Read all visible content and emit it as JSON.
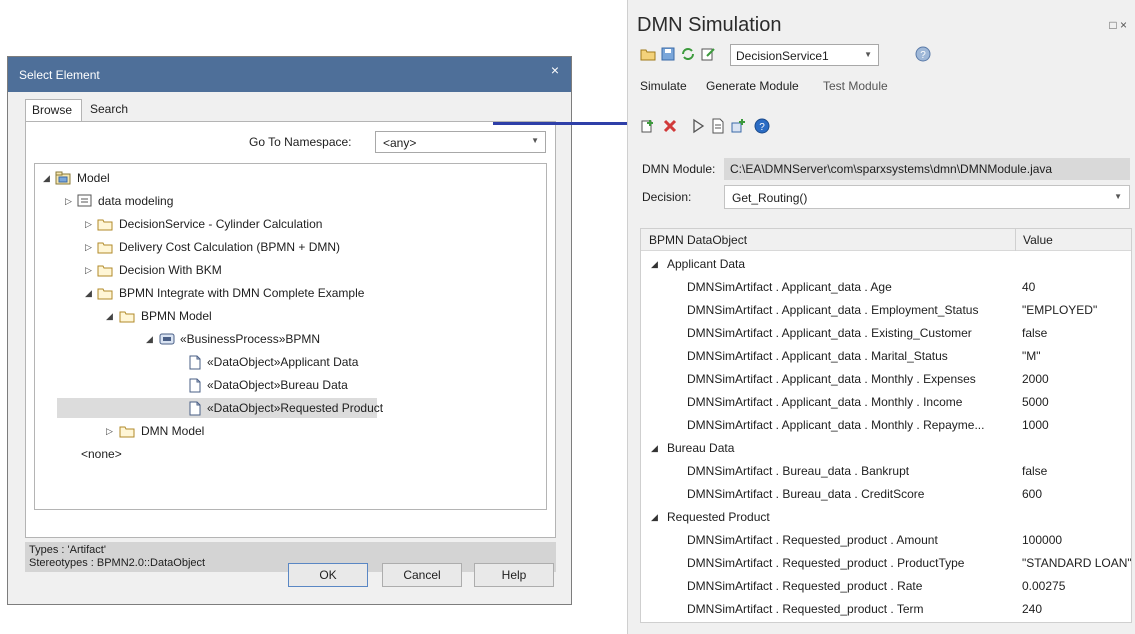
{
  "dialog": {
    "title": "Select Element",
    "close_glyph": "×",
    "tabs": [
      "Browse",
      "Search"
    ],
    "namespace_label": "Go To Namespace:",
    "namespace_value": "<any>",
    "tree": [
      {
        "label": "Model",
        "icon": "model-icon",
        "expander": "expanded"
      },
      {
        "label": "data modeling",
        "icon": "package-diagram-icon",
        "expander": "collapsed"
      },
      {
        "label": "DecisionService - Cylinder Calculation",
        "icon": "folder-icon",
        "expander": "collapsed"
      },
      {
        "label": "Delivery Cost Calculation (BPMN + DMN)",
        "icon": "folder-icon",
        "expander": "collapsed"
      },
      {
        "label": "Decision With BKM",
        "icon": "folder-icon",
        "expander": "collapsed"
      },
      {
        "label": "BPMN Integrate with DMN Complete Example",
        "icon": "folder-icon",
        "expander": "expanded"
      },
      {
        "label": "BPMN Model",
        "icon": "folder-icon",
        "expander": "expanded"
      },
      {
        "label": "«BusinessProcess»BPMN",
        "icon": "business-process-icon",
        "expander": "expanded"
      },
      {
        "label": "«DataObject»Applicant Data",
        "icon": "document-icon",
        "expander": "none"
      },
      {
        "label": "«DataObject»Bureau Data",
        "icon": "document-icon",
        "expander": "none"
      },
      {
        "label": "«DataObject»Requested Product",
        "icon": "document-icon",
        "expander": "none",
        "selected": true
      },
      {
        "label": "DMN Model",
        "icon": "folder-icon",
        "expander": "collapsed"
      },
      {
        "label": "<none>",
        "icon": "",
        "expander": "none"
      }
    ],
    "status_line1": "Types : 'Artifact'",
    "status_line2": "Stereotypes : BPMN2.0::DataObject",
    "buttons": {
      "ok": "OK",
      "cancel": "Cancel",
      "help": "Help"
    }
  },
  "sim": {
    "title": "DMN Simulation",
    "window_glyphs": "□ ×",
    "service_value": "DecisionService1",
    "menu": [
      "Simulate",
      "Generate Module",
      "Test Module"
    ],
    "module_label": "DMN Module:",
    "module_value": "C:\\EA\\DMNServer\\com\\sparxsystems\\dmn\\DMNModule.java",
    "decision_label": "Decision:",
    "decision_value": "Get_Routing()",
    "grid_headers": {
      "object": "BPMN DataObject",
      "value": "Value"
    },
    "groups": [
      {
        "name": "Applicant Data",
        "rows": [
          {
            "key": "DMNSimArtifact . Applicant_data . Age",
            "value": "40"
          },
          {
            "key": "DMNSimArtifact . Applicant_data . Employment_Status",
            "value": "\"EMPLOYED\""
          },
          {
            "key": "DMNSimArtifact . Applicant_data . Existing_Customer",
            "value": "false"
          },
          {
            "key": "DMNSimArtifact . Applicant_data . Marital_Status",
            "value": "\"M\""
          },
          {
            "key": "DMNSimArtifact . Applicant_data . Monthly . Expenses",
            "value": "2000"
          },
          {
            "key": "DMNSimArtifact . Applicant_data . Monthly . Income",
            "value": "5000"
          },
          {
            "key": "DMNSimArtifact . Applicant_data . Monthly . Repayme...",
            "value": "1000"
          }
        ]
      },
      {
        "name": "Bureau Data",
        "rows": [
          {
            "key": "DMNSimArtifact . Bureau_data . Bankrupt",
            "value": "false"
          },
          {
            "key": "DMNSimArtifact . Bureau_data . CreditScore",
            "value": "600"
          }
        ]
      },
      {
        "name": "Requested Product",
        "rows": [
          {
            "key": "DMNSimArtifact . Requested_product . Amount",
            "value": "100000"
          },
          {
            "key": "DMNSimArtifact . Requested_product . ProductType",
            "value": "\"STANDARD LOAN\""
          },
          {
            "key": "DMNSimArtifact . Requested_product . Rate",
            "value": "0.00275"
          },
          {
            "key": "DMNSimArtifact . Requested_product . Term",
            "value": "240"
          }
        ]
      }
    ]
  }
}
